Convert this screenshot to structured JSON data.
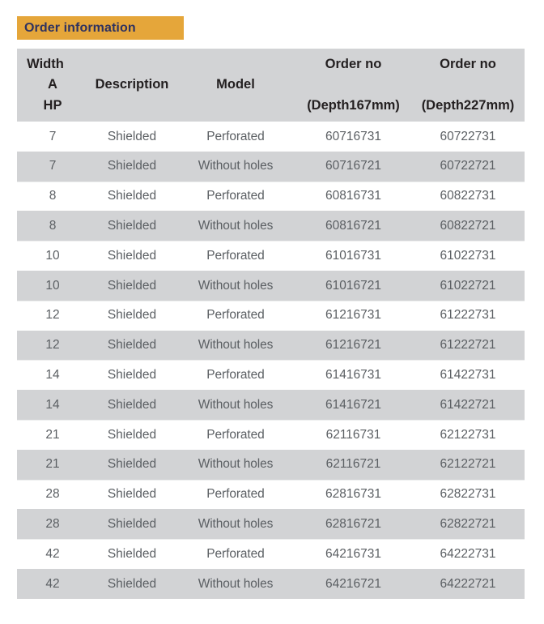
{
  "section": {
    "title": "Order information",
    "banner_bg": "#e5a63a",
    "banner_text_color": "#2e3260"
  },
  "table": {
    "header_bg": "#d2d3d5",
    "row_alt_bg": "#d2d3d5",
    "row_bg": "#ffffff",
    "text_color": "#5b5f63",
    "header_text_color": "#231f20",
    "columns": [
      {
        "key": "width",
        "lines": [
          "Width",
          "A",
          "HP"
        ]
      },
      {
        "key": "description",
        "lines": [
          "",
          "Description",
          ""
        ]
      },
      {
        "key": "model",
        "lines": [
          "",
          "Model",
          ""
        ]
      },
      {
        "key": "order_no_167",
        "lines": [
          "Order no",
          "",
          "(Depth167mm)"
        ]
      },
      {
        "key": "order_no_227",
        "lines": [
          "Order no",
          "",
          "(Depth227mm)"
        ]
      }
    ],
    "rows": [
      {
        "width": "7",
        "description": "Shielded",
        "model": "Perforated",
        "order_no_167": "60716731",
        "order_no_227": "60722731"
      },
      {
        "width": "7",
        "description": "Shielded",
        "model": "Without holes",
        "order_no_167": "60716721",
        "order_no_227": "60722721"
      },
      {
        "width": "8",
        "description": "Shielded",
        "model": "Perforated",
        "order_no_167": "60816731",
        "order_no_227": "60822731"
      },
      {
        "width": "8",
        "description": "Shielded",
        "model": "Without holes",
        "order_no_167": "60816721",
        "order_no_227": "60822721"
      },
      {
        "width": "10",
        "description": "Shielded",
        "model": "Perforated",
        "order_no_167": "61016731",
        "order_no_227": "61022731"
      },
      {
        "width": "10",
        "description": "Shielded",
        "model": "Without holes",
        "order_no_167": "61016721",
        "order_no_227": "61022721"
      },
      {
        "width": "12",
        "description": "Shielded",
        "model": "Perforated",
        "order_no_167": "61216731",
        "order_no_227": "61222731"
      },
      {
        "width": "12",
        "description": "Shielded",
        "model": "Without holes",
        "order_no_167": "61216721",
        "order_no_227": "61222721"
      },
      {
        "width": "14",
        "description": "Shielded",
        "model": "Perforated",
        "order_no_167": "61416731",
        "order_no_227": "61422731"
      },
      {
        "width": "14",
        "description": "Shielded",
        "model": "Without holes",
        "order_no_167": "61416721",
        "order_no_227": "61422721"
      },
      {
        "width": "21",
        "description": "Shielded",
        "model": "Perforated",
        "order_no_167": "62116731",
        "order_no_227": "62122731"
      },
      {
        "width": "21",
        "description": "Shielded",
        "model": "Without holes",
        "order_no_167": "62116721",
        "order_no_227": "62122721"
      },
      {
        "width": "28",
        "description": "Shielded",
        "model": "Perforated",
        "order_no_167": "62816731",
        "order_no_227": "62822731"
      },
      {
        "width": "28",
        "description": "Shielded",
        "model": "Without holes",
        "order_no_167": "62816721",
        "order_no_227": "62822721"
      },
      {
        "width": "42",
        "description": "Shielded",
        "model": "Perforated",
        "order_no_167": "64216731",
        "order_no_227": "64222731"
      },
      {
        "width": "42",
        "description": "Shielded",
        "model": "Without holes",
        "order_no_167": "64216721",
        "order_no_227": "64222721"
      }
    ]
  }
}
